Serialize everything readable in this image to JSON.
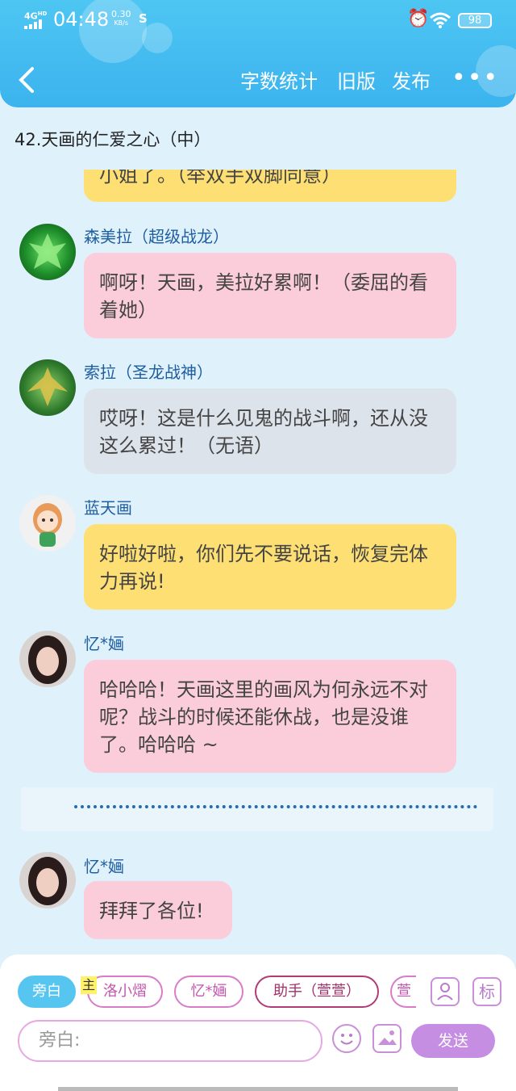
{
  "status_bar": {
    "network": "4G",
    "network_sup": "HD",
    "time": "04:48",
    "speed_value": "0.30",
    "speed_unit": "KB/s",
    "app_icon": "S",
    "battery": "98"
  },
  "nav": {
    "word_count": "字数统计",
    "old_version": "旧版",
    "publish": "发布",
    "more": "•••"
  },
  "chapter_title": "42.天画的仁爱之心（中）",
  "messages": [
    {
      "text": "小姐了。（举双手双脚同意）"
    },
    {
      "sender": "森美拉（超级战龙）",
      "text": "啊呀！天画，美拉好累啊！（委屈的看着她）"
    },
    {
      "sender": "索拉（圣龙战神）",
      "text": "哎呀！这是什么见鬼的战斗啊，还从没这么累过！（无语）"
    },
    {
      "sender": "蓝天画",
      "text": "好啦好啦，你们先不要说话，恢复完体力再说!"
    },
    {
      "sender": "忆*婳",
      "text": "哈哈哈！天画这里的画风为何永远不对呢？战斗的时候还能休战，也是没谁了。哈哈哈 ~"
    },
    {
      "sender": "忆*婳",
      "text": "拜拜了各位!"
    }
  ],
  "roles": {
    "narration": "旁白",
    "host_badge": "主",
    "role1": "洛小熠",
    "role2": "忆*婳",
    "role3": "助手（萱萱）",
    "role4": "萱",
    "mark_btn": "标"
  },
  "composer": {
    "placeholder": "旁白:",
    "send": "发送"
  }
}
